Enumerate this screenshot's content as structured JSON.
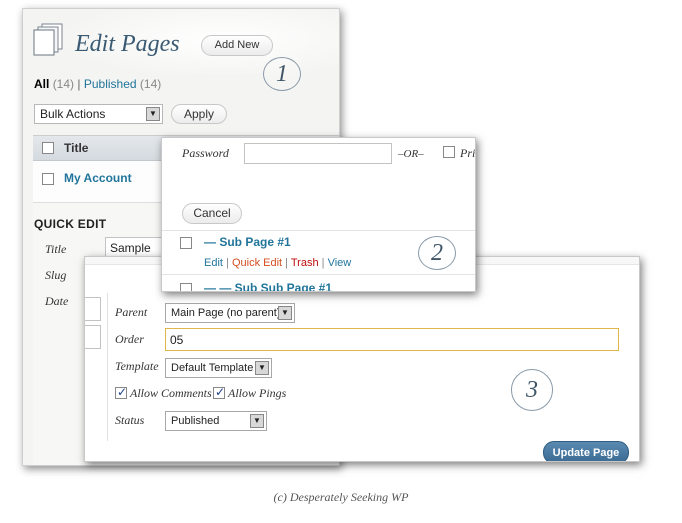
{
  "panel1": {
    "title": "Edit Pages",
    "add_new_label": "Add New",
    "filters": {
      "all_label": "All",
      "all_count": "(14)",
      "separator": "|",
      "published_label": "Published",
      "published_count": "(14)"
    },
    "bulk_actions": {
      "selected": "Bulk Actions"
    },
    "apply_label": "Apply",
    "table": {
      "header_title": "Title",
      "rows": [
        {
          "title": "My Account"
        }
      ]
    },
    "quick_edit": {
      "heading": "QUICK EDIT",
      "labels": {
        "title": "Title",
        "slug": "Slug",
        "date": "Date"
      },
      "title_value": "Sample"
    }
  },
  "panel2": {
    "password_label": "Password",
    "password_value": "",
    "or_label": "–OR–",
    "private_label": "Pri",
    "cancel_label": "Cancel",
    "rows": [
      {
        "title": "— Sub Page #1"
      },
      {
        "title": "— — Sub Sub Page #1"
      }
    ],
    "row_actions": {
      "edit": "Edit",
      "quick_edit": "Quick Edit",
      "trash": "Trash",
      "view": "View",
      "separator": "|"
    }
  },
  "panel3": {
    "parent": {
      "label": "Parent",
      "selected": "Main Page (no parent)"
    },
    "order": {
      "label": "Order",
      "value": "05"
    },
    "template": {
      "label": "Template",
      "selected": "Default Template"
    },
    "allow_comments": {
      "label": "Allow Comments",
      "checked": true
    },
    "allow_pings": {
      "label": "Allow Pings",
      "checked": true
    },
    "status": {
      "label": "Status",
      "selected": "Published"
    },
    "update_label": "Update Page"
  },
  "annotations": {
    "one": "1",
    "two": "2",
    "three": "3"
  },
  "caption": "(c) Desperately Seeking WP",
  "icons": [
    "pages-icon",
    "chevron-down-icon",
    "checkbox-icon",
    "checkmark-icon"
  ],
  "colors": {
    "link": "#21759b",
    "quick_edit": "#d54e21",
    "trash": "#bc0b0b",
    "update_button": "#4a7aa2",
    "title": "#3a5a73"
  }
}
